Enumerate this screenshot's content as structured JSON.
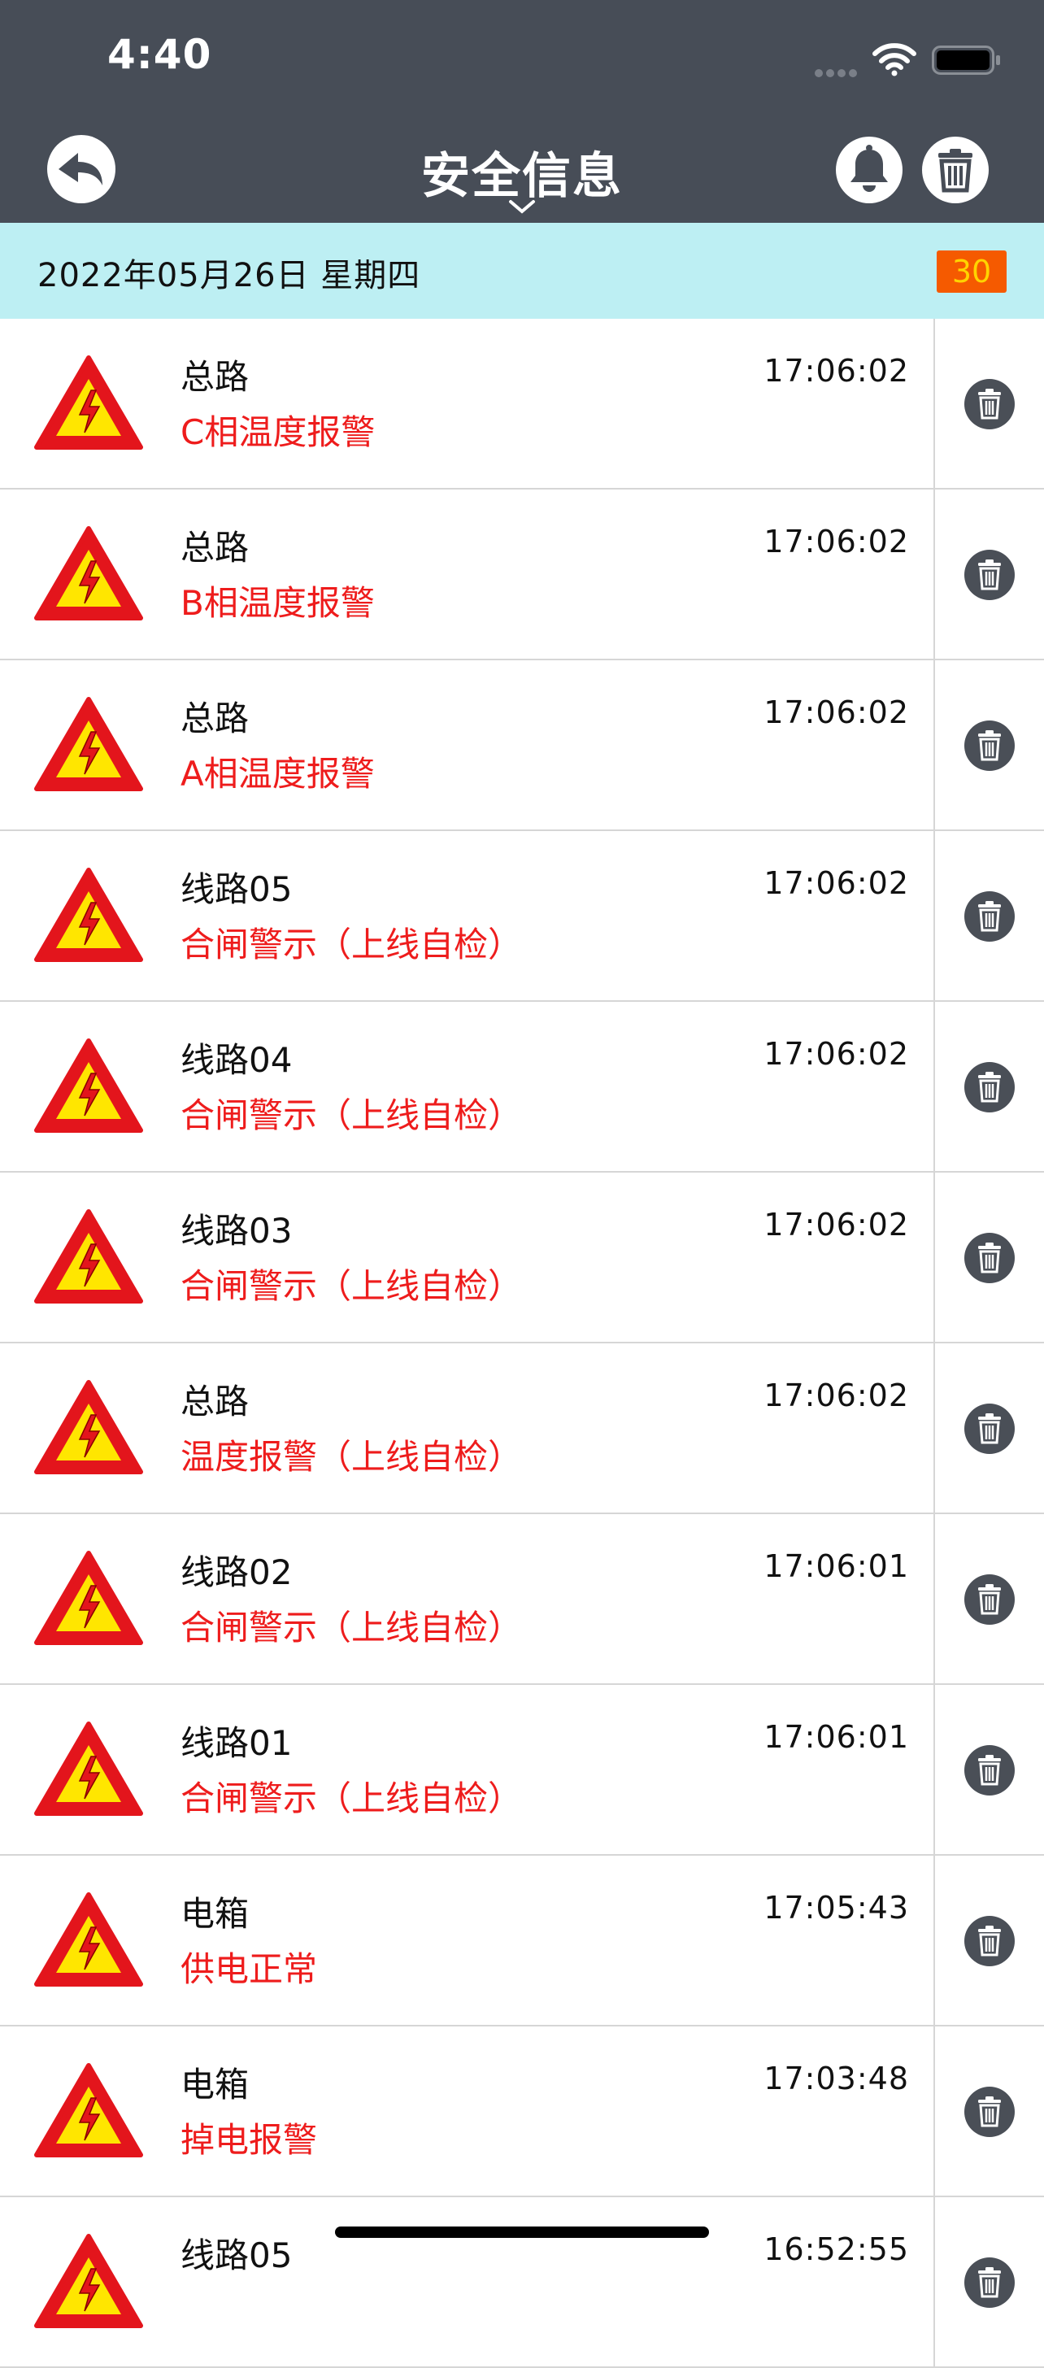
{
  "status_bar": {
    "time": "4:40"
  },
  "header": {
    "title": "安全信息"
  },
  "date_bar": {
    "date": "2022年05月26日 星期四",
    "count": "30"
  },
  "colors": {
    "header_bg": "#474d57",
    "date_bar_bg": "#bdeff3",
    "alarm_text": "#ee1c1c",
    "badge_bg": "#f55a00",
    "badge_text": "#ffd400"
  },
  "items": [
    {
      "name": "总路",
      "status": "C相温度报警",
      "time": "17:06:02"
    },
    {
      "name": "总路",
      "status": "B相温度报警",
      "time": "17:06:02"
    },
    {
      "name": "总路",
      "status": "A相温度报警",
      "time": "17:06:02"
    },
    {
      "name": "线路05",
      "status": "合闸警示（上线自检）",
      "time": "17:06:02"
    },
    {
      "name": "线路04",
      "status": "合闸警示（上线自检）",
      "time": "17:06:02"
    },
    {
      "name": "线路03",
      "status": "合闸警示（上线自检）",
      "time": "17:06:02"
    },
    {
      "name": "总路",
      "status": "温度报警（上线自检）",
      "time": "17:06:02"
    },
    {
      "name": "线路02",
      "status": "合闸警示（上线自检）",
      "time": "17:06:01"
    },
    {
      "name": "线路01",
      "status": "合闸警示（上线自检）",
      "time": "17:06:01"
    },
    {
      "name": "电箱",
      "status": "供电正常",
      "time": "17:05:43"
    },
    {
      "name": "电箱",
      "status": "掉电报警",
      "time": "17:03:48"
    },
    {
      "name": "线路05",
      "status": "",
      "time": "16:52:55"
    }
  ]
}
